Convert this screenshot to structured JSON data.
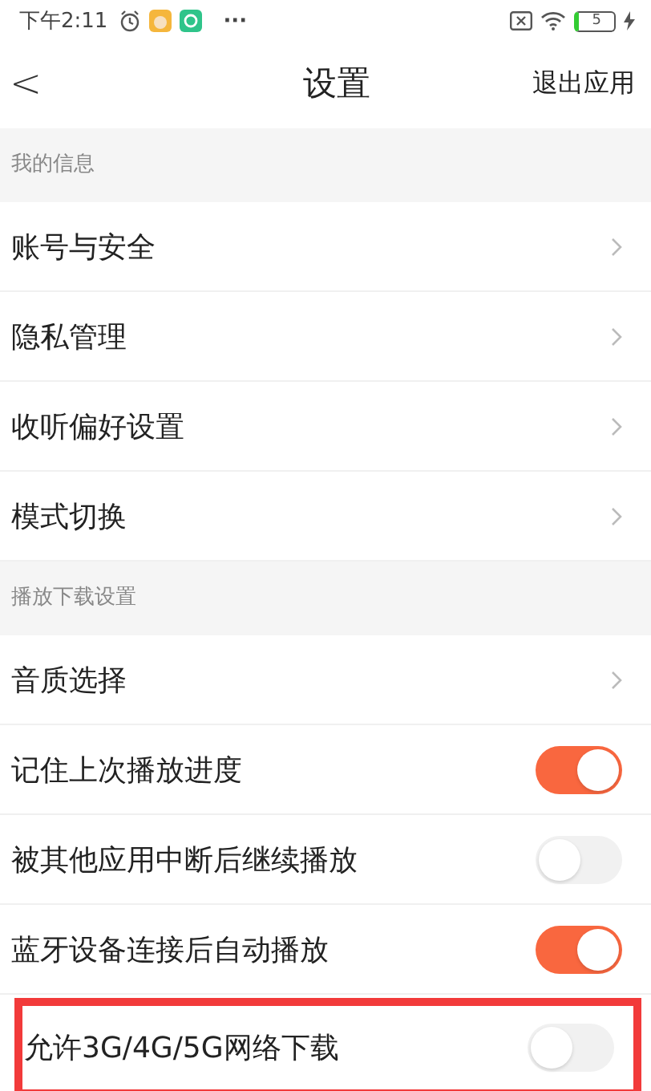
{
  "status_bar": {
    "time": "下午2:11",
    "more": "···",
    "battery": "5"
  },
  "header": {
    "back": "<",
    "title": "设置",
    "action": "退出应用"
  },
  "sections": [
    {
      "title": "我的信息",
      "items": [
        {
          "kind": "link",
          "label": "账号与安全"
        },
        {
          "kind": "link",
          "label": "隐私管理"
        },
        {
          "kind": "link",
          "label": "收听偏好设置"
        },
        {
          "kind": "link",
          "label": "模式切换"
        }
      ]
    },
    {
      "title": "播放下载设置",
      "items": [
        {
          "kind": "link",
          "label": "音质选择"
        },
        {
          "kind": "toggle",
          "label": "记住上次播放进度",
          "on": true
        },
        {
          "kind": "toggle",
          "label": "被其他应用中断后继续播放",
          "on": false
        },
        {
          "kind": "toggle",
          "label": "蓝牙设备连接后自动播放",
          "on": true
        },
        {
          "kind": "toggle",
          "label": "允许3G/4G/5G网络下载",
          "on": false,
          "highlighted": true
        }
      ]
    }
  ]
}
